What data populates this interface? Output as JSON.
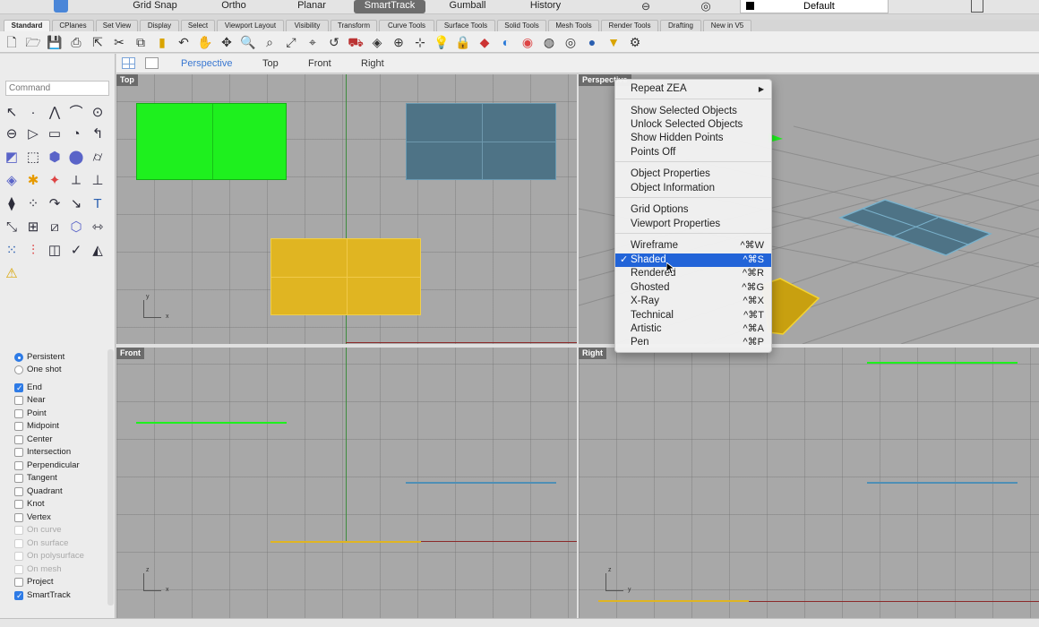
{
  "modebar": {
    "items": [
      "Grid Snap",
      "Ortho",
      "Planar",
      "SmartTrack",
      "Gumball",
      "History"
    ],
    "active": "SmartTrack",
    "layer": "Default"
  },
  "tabs": [
    "Standard",
    "CPlanes",
    "Set View",
    "Display",
    "Select",
    "Viewport Layout",
    "Visibility",
    "Transform",
    "Curve Tools",
    "Surface Tools",
    "Solid Tools",
    "Mesh Tools",
    "Render Tools",
    "Drafting",
    "New in V5"
  ],
  "command": {
    "placeholder": "Command"
  },
  "viewport_tabs": [
    "Perspective",
    "Top",
    "Front",
    "Right"
  ],
  "viewports": {
    "top": "Top",
    "perspective": "Perspective",
    "front": "Front",
    "right": "Right"
  },
  "axes": {
    "x": "x",
    "y": "y",
    "z": "z"
  },
  "osnaps": [
    {
      "label": "Persistent",
      "kind": "radio",
      "checked": true
    },
    {
      "label": "One shot",
      "kind": "radio",
      "checked": false
    },
    {
      "label": "End",
      "kind": "check",
      "checked": true
    },
    {
      "label": "Near",
      "kind": "check",
      "checked": false
    },
    {
      "label": "Point",
      "kind": "check",
      "checked": false
    },
    {
      "label": "Midpoint",
      "kind": "check",
      "checked": false
    },
    {
      "label": "Center",
      "kind": "check",
      "checked": false
    },
    {
      "label": "Intersection",
      "kind": "check",
      "checked": false
    },
    {
      "label": "Perpendicular",
      "kind": "check",
      "checked": false
    },
    {
      "label": "Tangent",
      "kind": "check",
      "checked": false
    },
    {
      "label": "Quadrant",
      "kind": "check",
      "checked": false
    },
    {
      "label": "Knot",
      "kind": "check",
      "checked": false
    },
    {
      "label": "Vertex",
      "kind": "check",
      "checked": false
    },
    {
      "label": "On curve",
      "kind": "check",
      "checked": false,
      "disabled": true
    },
    {
      "label": "On surface",
      "kind": "check",
      "checked": false,
      "disabled": true
    },
    {
      "label": "On polysurface",
      "kind": "check",
      "checked": false,
      "disabled": true
    },
    {
      "label": "On mesh",
      "kind": "check",
      "checked": false,
      "disabled": true
    },
    {
      "label": "Project",
      "kind": "check",
      "checked": false
    },
    {
      "label": "SmartTrack",
      "kind": "check",
      "checked": true
    }
  ],
  "context_menu": {
    "items": [
      {
        "label": "Repeat ZEA",
        "submenu": "▶"
      },
      {
        "label": "Show Selected Objects"
      },
      {
        "label": "Unlock Selected Objects"
      },
      {
        "label": "Show Hidden Points"
      },
      {
        "label": "Points Off"
      },
      {
        "label": "Object Properties"
      },
      {
        "label": "Object Information"
      },
      {
        "label": "Grid Options"
      },
      {
        "label": "Viewport Properties"
      },
      {
        "label": "Wireframe",
        "shortcut": "^⌘W"
      },
      {
        "label": "Shaded",
        "shortcut": "^⌘S",
        "checked": true,
        "selected": true
      },
      {
        "label": "Rendered",
        "shortcut": "^⌘R"
      },
      {
        "label": "Ghosted",
        "shortcut": "^⌘G"
      },
      {
        "label": "X-Ray",
        "shortcut": "^⌘X"
      },
      {
        "label": "Technical",
        "shortcut": "^⌘T"
      },
      {
        "label": "Artistic",
        "shortcut": "^⌘A"
      },
      {
        "label": "Pen",
        "shortcut": "^⌘P"
      }
    ]
  },
  "colors": {
    "green": "#1ef01e",
    "blue": "#4e7386",
    "yellow": "#e0b522",
    "selection": "#2264d8",
    "axis_red": "#8b2a2a",
    "axis_green": "#3d8a3d"
  }
}
